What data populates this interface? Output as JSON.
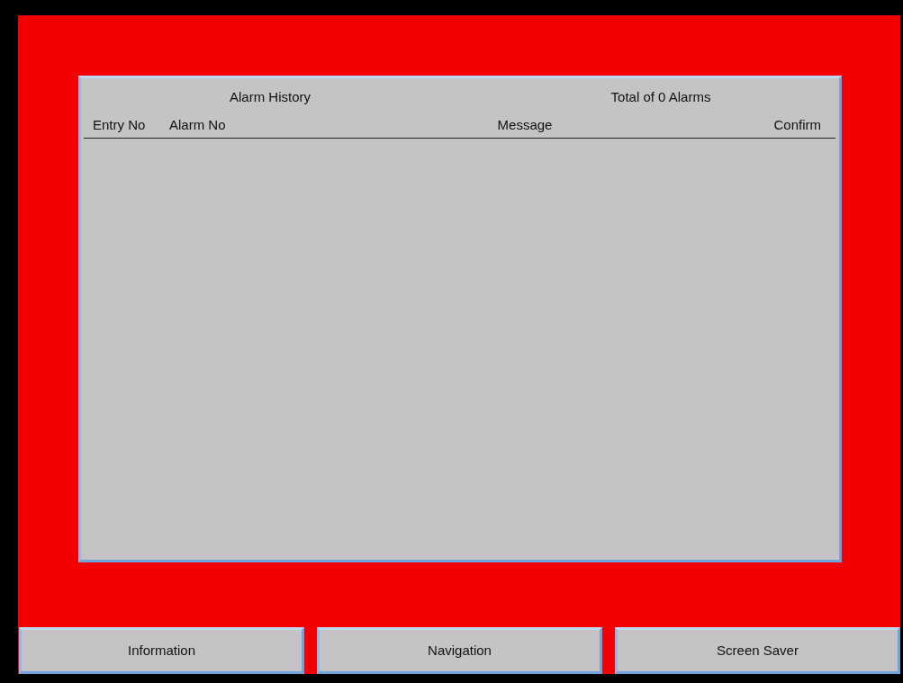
{
  "panel": {
    "title": "Alarm History",
    "total": "Total of 0 Alarms",
    "columns": [
      "Entry No",
      "Alarm No",
      "Message",
      "Confirm"
    ]
  },
  "buttons": [
    "Information",
    "Navigation",
    "Screen Saver"
  ]
}
